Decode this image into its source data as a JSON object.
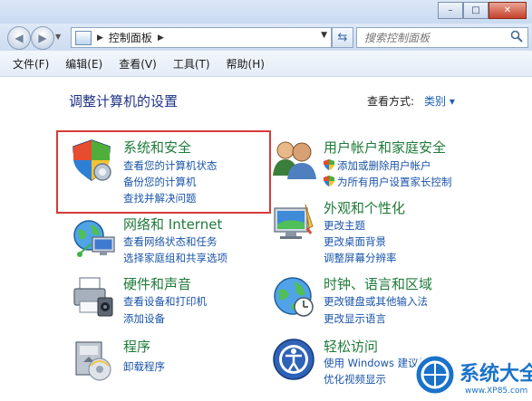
{
  "window": {
    "minimize_label": "–",
    "maximize_label": "□",
    "close_label": "✕"
  },
  "address": {
    "crumb": "控制面板",
    "search_placeholder": "搜索控制面板"
  },
  "menu": [
    "文件(F)",
    "编辑(E)",
    "查看(V)",
    "工具(T)",
    "帮助(H)"
  ],
  "main": {
    "heading": "调整计算机的设置",
    "view_by_label": "查看方式:",
    "view_by_value": "类别 ▾"
  },
  "categories": [
    {
      "title": "系统和安全",
      "links": [
        "查看您的计算机状态",
        "备份您的计算机",
        "查找并解决问题"
      ],
      "icon": "shield-icon"
    },
    {
      "title": "网络和 Internet",
      "links": [
        "查看网络状态和任务",
        "选择家庭组和共享选项"
      ],
      "icon": "network-icon"
    },
    {
      "title": "硬件和声音",
      "links": [
        "查看设备和打印机",
        "添加设备"
      ],
      "icon": "printer-icon"
    },
    {
      "title": "程序",
      "links": [
        "卸载程序"
      ],
      "icon": "programs-icon"
    },
    {
      "title": "用户帐户和家庭安全",
      "links": [
        "添加或删除用户帐户",
        "为所有用户设置家长控制"
      ],
      "icon": "users-icon"
    },
    {
      "title": "外观和个性化",
      "links": [
        "更改主题",
        "更改桌面背景",
        "调整屏幕分辨率"
      ],
      "icon": "appearance-icon"
    },
    {
      "title": "时钟、语言和区域",
      "links": [
        "更改键盘或其他输入法",
        "更改显示语言"
      ],
      "icon": "globe-clock-icon"
    },
    {
      "title": "轻松访问",
      "links": [
        "使用 Windows 建议的设置",
        "优化视频显示"
      ],
      "icon": "ease-of-access-icon"
    }
  ],
  "watermark": {
    "text": "系统大全",
    "url": "www.XP85.com"
  }
}
